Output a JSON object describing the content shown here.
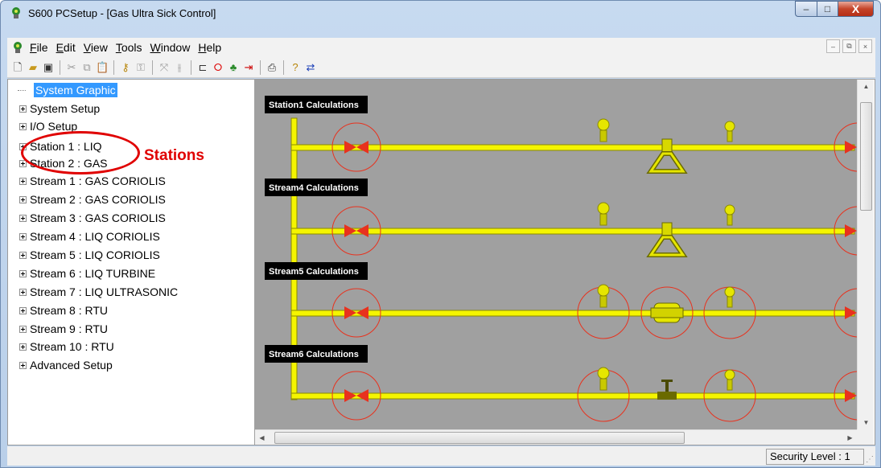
{
  "window": {
    "title": "S600 PCSetup  - [Gas Ultra Sick Control]",
    "controls": {
      "minimize": "–",
      "maximize": "□",
      "close": "X"
    }
  },
  "menu": {
    "items": [
      {
        "label": "File",
        "hotkey": "F",
        "rest": "ile"
      },
      {
        "label": "Edit",
        "hotkey": "E",
        "rest": "dit"
      },
      {
        "label": "View",
        "hotkey": "V",
        "rest": "iew"
      },
      {
        "label": "Tools",
        "hotkey": "T",
        "rest": "ools"
      },
      {
        "label": "Window",
        "hotkey": "W",
        "rest": "indow"
      },
      {
        "label": "Help",
        "hotkey": "H",
        "rest": "elp"
      }
    ],
    "mdi_controls": {
      "minimize": "–",
      "restore": "⧉",
      "close": "×"
    }
  },
  "toolbar": {
    "icons": [
      "new-icon",
      "open-icon",
      "save-icon",
      "sep",
      "cut-icon",
      "copy-icon",
      "paste-icon",
      "sep",
      "key-icon",
      "lock-icon",
      "sep",
      "network-icon",
      "meter-icon",
      "sep",
      "connect-icon",
      "stop-icon",
      "tree-icon",
      "transfer-icon",
      "sep",
      "print-icon",
      "sep",
      "help-icon",
      "swap-icon"
    ]
  },
  "tree": {
    "items": [
      {
        "label": "System Graphic",
        "selected": true,
        "expandable": false
      },
      {
        "label": "System Setup",
        "expandable": true
      },
      {
        "label": "I/O Setup",
        "expandable": true
      },
      {
        "label": "Station 1 : LIQ",
        "expandable": true
      },
      {
        "label": "Station 2 : GAS",
        "expandable": true
      },
      {
        "label": "Stream 1 : GAS CORIOLIS",
        "expandable": true
      },
      {
        "label": "Stream 2 : GAS CORIOLIS",
        "expandable": true
      },
      {
        "label": "Stream 3 : GAS CORIOLIS",
        "expandable": true
      },
      {
        "label": "Stream 4 : LIQ CORIOLIS",
        "expandable": true
      },
      {
        "label": "Stream 5 : LIQ CORIOLIS",
        "expandable": true
      },
      {
        "label": "Stream 6 : LIQ TURBINE",
        "expandable": true
      },
      {
        "label": "Stream 7 : LIQ ULTRASONIC",
        "expandable": true
      },
      {
        "label": "Stream 8 : RTU",
        "expandable": true
      },
      {
        "label": "Stream 9 : RTU",
        "expandable": true
      },
      {
        "label": "Stream 10 : RTU",
        "expandable": true
      },
      {
        "label": "Advanced Setup",
        "expandable": true
      }
    ]
  },
  "annotation": {
    "text": "Stations",
    "color": "#e00000"
  },
  "graphic": {
    "background": "#a0a0a0",
    "pipe_color": "#f5f500",
    "valve_color": "#e8321e",
    "runs": [
      {
        "label": "Station1 Calculations",
        "meter": "coriolis"
      },
      {
        "label": "Stream4 Calculations",
        "meter": "coriolis"
      },
      {
        "label": "Stream5 Calculations",
        "meter": "turbine"
      },
      {
        "label": "Stream6 Calculations",
        "meter": "ultrasonic"
      }
    ],
    "transmitter_p": "P",
    "transmitter_t": "T"
  },
  "status": {
    "security": "Security Level : 1"
  }
}
